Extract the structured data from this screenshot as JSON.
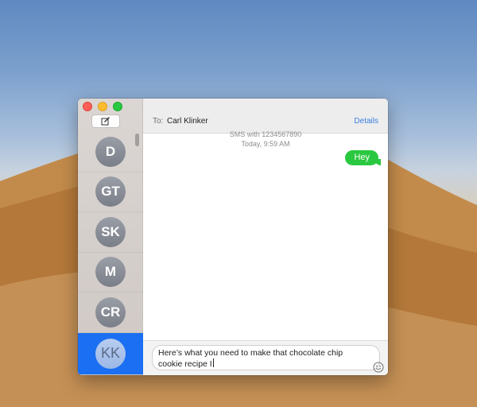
{
  "window": {
    "compose_icon": "compose-icon",
    "scroll_icon": "scrollbar"
  },
  "conversations": [
    {
      "initials": "D"
    },
    {
      "initials": "GT"
    },
    {
      "initials": "SK"
    },
    {
      "initials": "M"
    },
    {
      "initials": "CR"
    },
    {
      "initials": "KK",
      "selected": true
    }
  ],
  "header": {
    "to_label": "To:",
    "recipient": "Carl Klinker",
    "details_label": "Details"
  },
  "thread": {
    "service_line": "SMS with 1234567890",
    "timestamp": "Today, 9:59 AM",
    "messages": [
      {
        "text": "Hey",
        "from_me": true
      }
    ]
  },
  "composer": {
    "draft_text": "Here’s what you need to make that chocolate chip cookie recipe I",
    "emoji_icon": "emoji-icon"
  },
  "colors": {
    "accent": "#1a6ff2",
    "sms_bubble": "#2ac840",
    "link": "#3b7fe0"
  }
}
